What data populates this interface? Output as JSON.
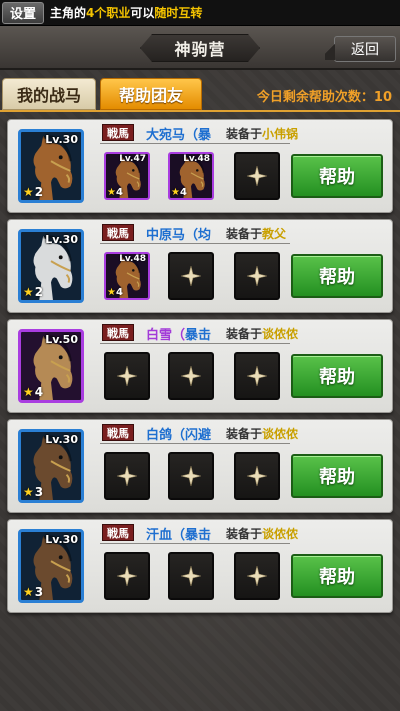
{
  "notice": {
    "settings_label": "设置",
    "text_prefix": "主角的",
    "text_highlight1": "4个职业",
    "text_middle": "可以",
    "text_highlight2": "随时互转"
  },
  "header": {
    "title": "神驹营",
    "back_label": "返回"
  },
  "tabs": {
    "mine": "我的战马",
    "help": "帮助团友",
    "remaining_label": "今日剩余帮助次数：",
    "remaining_count": "10"
  },
  "colors": {
    "accent": "#f0a028",
    "help_button": "#3aa832",
    "blue_quality": "#2a7fd4",
    "purple_quality": "#a93de0",
    "owner_name": "#c9a000"
  },
  "cards": [
    {
      "level": "Lv.30",
      "stars": "2",
      "quality": "blue",
      "horse_color": "brown",
      "tag": "戦馬",
      "name": "大宛马（暴",
      "equip_label": "装备于",
      "owner": "小伟锅",
      "slots": [
        {
          "filled": true,
          "level": "Lv.47",
          "stars": "4"
        },
        {
          "filled": true,
          "level": "Lv.48",
          "stars": "4"
        },
        {
          "filled": false
        }
      ],
      "help_label": "帮助"
    },
    {
      "level": "Lv.30",
      "stars": "2",
      "quality": "blue",
      "horse_color": "white",
      "tag": "戦馬",
      "name": "中原马（均",
      "equip_label": "装备于",
      "owner": "教父",
      "slots": [
        {
          "filled": true,
          "level": "Lv.48",
          "stars": "4"
        },
        {
          "filled": false
        },
        {
          "filled": false
        }
      ],
      "help_label": "帮助"
    },
    {
      "level": "Lv.50",
      "stars": "4",
      "quality": "purple",
      "horse_color": "tan",
      "tag": "戦馬",
      "name": "白雪（",
      "skill": "暴击",
      "equip_label": "装备于",
      "owner": "谈侬侬",
      "slots": [
        {
          "filled": false
        },
        {
          "filled": false
        },
        {
          "filled": false
        }
      ],
      "help_label": "帮助"
    },
    {
      "level": "Lv.30",
      "stars": "3",
      "quality": "blue",
      "horse_color": "dark",
      "tag": "戦馬",
      "name": "白鸽（闪避",
      "equip_label": "装备于",
      "owner": "谈侬侬",
      "slots": [
        {
          "filled": false
        },
        {
          "filled": false
        },
        {
          "filled": false
        }
      ],
      "help_label": "帮助"
    },
    {
      "level": "Lv.30",
      "stars": "3",
      "quality": "blue",
      "horse_color": "dark",
      "tag": "戦馬",
      "name": "汗血（暴击",
      "equip_label": "装备于",
      "owner": "谈侬侬",
      "slots": [
        {
          "filled": false
        },
        {
          "filled": false
        },
        {
          "filled": false
        }
      ],
      "help_label": "帮助"
    }
  ]
}
